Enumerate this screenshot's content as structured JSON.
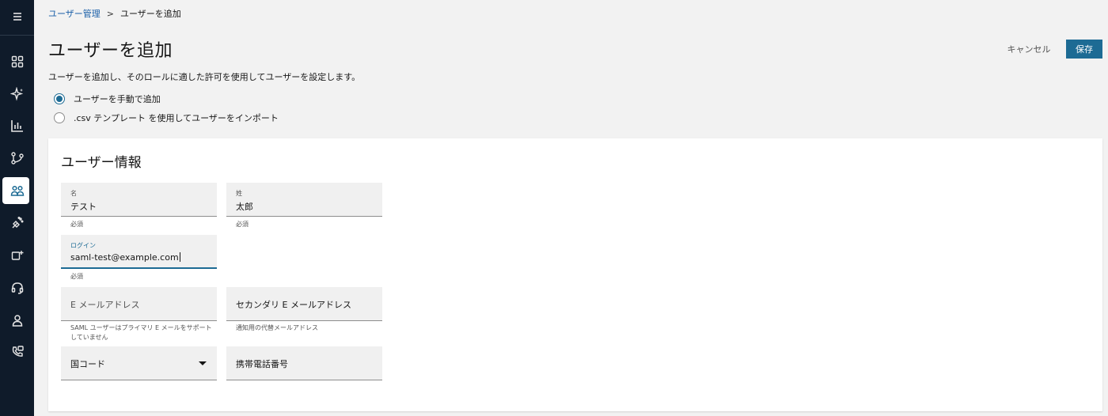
{
  "sidebar": {
    "items": [
      {
        "name": "menu-icon"
      },
      {
        "name": "dashboard-icon"
      },
      {
        "name": "sparkle-icon"
      },
      {
        "name": "analytics-icon"
      },
      {
        "name": "routing-icon"
      },
      {
        "name": "users-icon",
        "active": true
      },
      {
        "name": "channels-icon"
      },
      {
        "name": "integrations-icon"
      },
      {
        "name": "headset-icon"
      },
      {
        "name": "profile-icon"
      },
      {
        "name": "phone-icon"
      }
    ]
  },
  "breadcrumb": {
    "parent": "ユーザー管理",
    "separator": ">",
    "current": "ユーザーを追加"
  },
  "header": {
    "title": "ユーザーを追加",
    "cancel_label": "キャンセル",
    "save_label": "保存",
    "description": "ユーザーを追加し、そのロールに適した許可を使用してユーザーを設定します。"
  },
  "add_method": {
    "options": [
      {
        "label": "ユーザーを手動で追加",
        "selected": true
      },
      {
        "label": ".csv テンプレート を使用してユーザーをインポート",
        "selected": false
      }
    ]
  },
  "user_info": {
    "title": "ユーザー情報",
    "first_name": {
      "label": "名",
      "value": "テスト",
      "helper": "必須"
    },
    "last_name": {
      "label": "姓",
      "value": "太郎",
      "helper": "必須"
    },
    "login": {
      "label": "ログイン",
      "value": "saml-test@example.com",
      "helper": "必須"
    },
    "email": {
      "placeholder": "E メールアドレス",
      "helper": "SAML ユーザーはプライマリ E メールをサポートしていません"
    },
    "secondary_email": {
      "placeholder": "セカンダリ E メールアドレス",
      "helper": "通知用の代替メールアドレス"
    },
    "country_code": {
      "placeholder": "国コード"
    },
    "mobile": {
      "placeholder": "携帯電話番号"
    }
  },
  "colors": {
    "sidebar_bg": "#0f1b2a",
    "primary": "#1d6b94",
    "page_bg": "#f2f2f2"
  }
}
